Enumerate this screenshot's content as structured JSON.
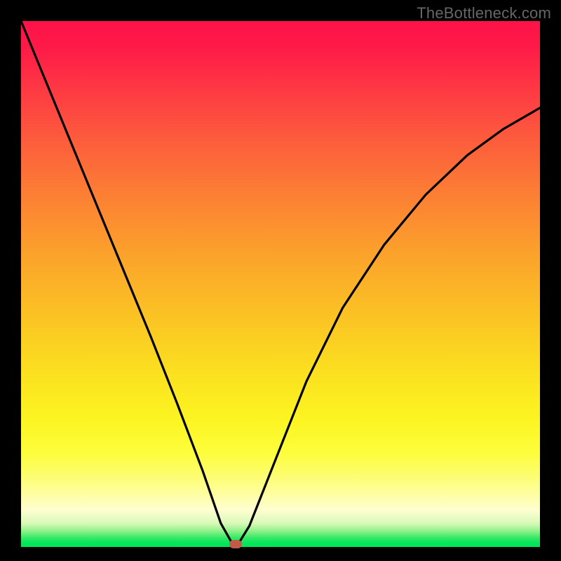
{
  "watermark": "TheBottleneck.com",
  "chart_data": {
    "type": "line",
    "title": "",
    "xlabel": "",
    "ylabel": "",
    "xlim": [
      0,
      1
    ],
    "ylim": [
      0,
      1
    ],
    "grid": false,
    "curve": {
      "x": [
        0.0,
        0.05,
        0.1,
        0.15,
        0.2,
        0.25,
        0.3,
        0.35,
        0.385,
        0.408,
        0.418,
        0.44,
        0.48,
        0.55,
        0.62,
        0.7,
        0.78,
        0.86,
        0.93,
        1.0
      ],
      "y": [
        1.0,
        0.88,
        0.76,
        0.64,
        0.52,
        0.4,
        0.275,
        0.145,
        0.045,
        0.005,
        0.005,
        0.04,
        0.14,
        0.315,
        0.455,
        0.575,
        0.67,
        0.745,
        0.795,
        0.835
      ]
    },
    "marker": {
      "x": 0.413,
      "y": 0.005
    },
    "gradient_stops": [
      {
        "pos": 0.0,
        "color": "#fe1248"
      },
      {
        "pos": 0.5,
        "color": "#fbb726"
      },
      {
        "pos": 0.82,
        "color": "#fdfd3b"
      },
      {
        "pos": 1.0,
        "color": "#01e557"
      }
    ]
  }
}
